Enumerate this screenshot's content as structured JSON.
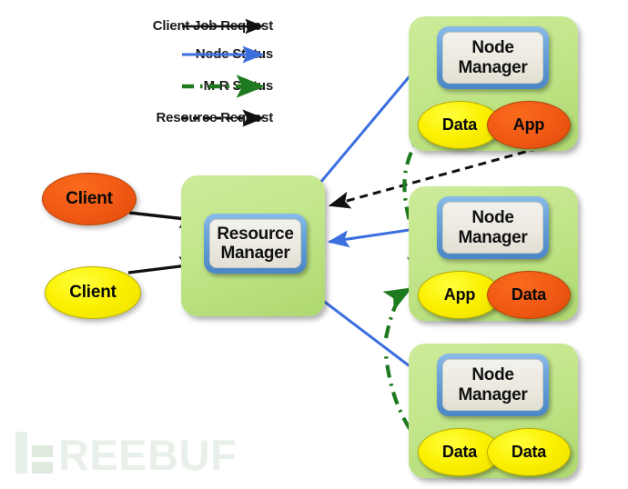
{
  "legend": {
    "items": [
      {
        "label": "Client Job Request",
        "style": "solid",
        "color": "#111111",
        "icon": "arrow-right-icon"
      },
      {
        "label": "Node Status",
        "style": "solid",
        "color": "#3b6fe0",
        "icon": "arrow-right-icon"
      },
      {
        "label": "M-R Status",
        "style": "dash-dot",
        "color": "#1f7a1f",
        "icon": "arrow-right-icon"
      },
      {
        "label": "Resource Request",
        "style": "dashed",
        "color": "#111111",
        "icon": "arrow-right-icon"
      }
    ]
  },
  "clients": [
    {
      "label": "Client",
      "color": "#f0570f"
    },
    {
      "label": "Client",
      "color": "#fbf000"
    }
  ],
  "resource_manager": {
    "line1": "Resource",
    "line2": "Manager"
  },
  "nodes": [
    {
      "title_line1": "Node",
      "title_line2": "Manager",
      "containers": [
        {
          "label": "Data",
          "color": "#fbf000"
        },
        {
          "label": "App",
          "color": "#f0570f"
        }
      ]
    },
    {
      "title_line1": "Node",
      "title_line2": "Manager",
      "containers": [
        {
          "label": "App",
          "color": "#fbf000"
        },
        {
          "label": "Data",
          "color": "#f0570f"
        }
      ]
    },
    {
      "title_line1": "Node",
      "title_line2": "Manager",
      "containers": [
        {
          "label": "Data",
          "color": "#fbf000"
        },
        {
          "label": "Data",
          "color": "#fbf000"
        }
      ]
    }
  ],
  "watermark": {
    "text": "REEBUF"
  },
  "colors": {
    "green_box": "#c3e68b",
    "blue_frame": "#4b86c6",
    "inner_box": "#ece9e0",
    "yellow": "#fbf000",
    "orange": "#f0570f",
    "blue_arrow": "#3b6fe0",
    "green_arrow": "#1f7a1f",
    "black_arrow": "#111111"
  }
}
